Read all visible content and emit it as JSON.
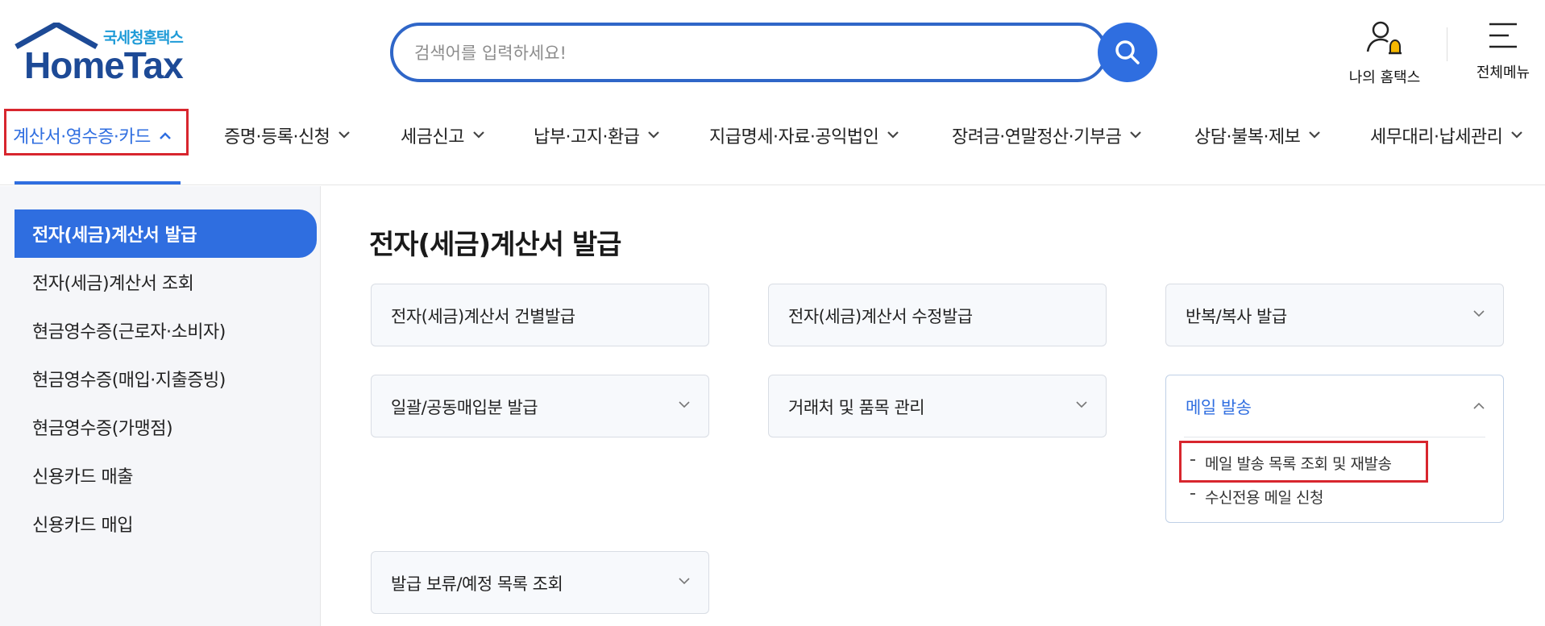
{
  "brand": {
    "sub_title": "국세청홈택스",
    "name": "HomeTax",
    "house_color": "#1d4a96",
    "sub_color": "#1f9bd7"
  },
  "search": {
    "placeholder": "검색어를 입력하세요!",
    "icon": "search-icon"
  },
  "utility": {
    "my_hometax": "나의 홈택스",
    "all_menu": "전체메뉴"
  },
  "gnb": {
    "items": [
      {
        "label": "계산서·영수증·카드",
        "expanded": true
      },
      {
        "label": "증명·등록·신청"
      },
      {
        "label": "세금신고"
      },
      {
        "label": "납부·고지·환급"
      },
      {
        "label": "지급명세·자료·공익법인"
      },
      {
        "label": "장려금·연말정산·기부금"
      },
      {
        "label": "상담·불복·제보"
      },
      {
        "label": "세무대리·납세관리"
      }
    ]
  },
  "sidebar": {
    "items": [
      {
        "label": "전자(세금)계산서 발급",
        "active": true
      },
      {
        "label": "전자(세금)계산서 조회"
      },
      {
        "label": "현금영수증(근로자·소비자)"
      },
      {
        "label": "현금영수증(매입·지출증빙)"
      },
      {
        "label": "현금영수증(가맹점)"
      },
      {
        "label": "신용카드 매출"
      },
      {
        "label": "신용카드 매입"
      }
    ]
  },
  "main": {
    "title": "전자(세금)계산서 발급",
    "cards": [
      {
        "label": "전자(세금)계산서 건별발급"
      },
      {
        "label": "전자(세금)계산서 수정발급"
      },
      {
        "label": "반복/복사 발급"
      },
      {
        "label": "일괄/공동매입분 발급"
      },
      {
        "label": "거래처 및 품목 관리"
      },
      {
        "label": "메일 발송",
        "expanded": true,
        "sub_items": [
          "메일 발송 목록 조회 및 재발송",
          "수신전용 메일 신청"
        ]
      },
      {
        "label": "발급 보류/예정 목록 조회"
      }
    ]
  },
  "colors": {
    "accent": "#2f6ee0",
    "highlight_box": "#d8262e"
  }
}
